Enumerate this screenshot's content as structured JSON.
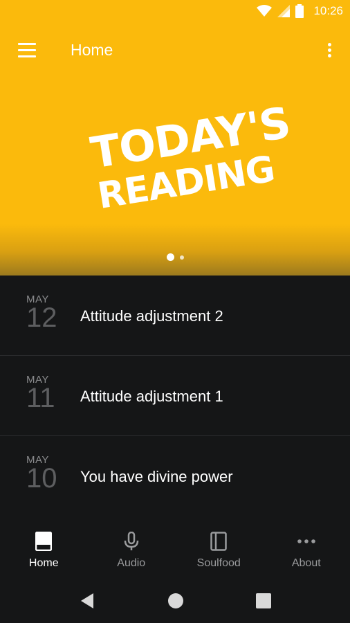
{
  "status_bar": {
    "time": "10:26"
  },
  "app_bar": {
    "title": "Home"
  },
  "hero": {
    "title_line1": "TODAY'S",
    "title_line2": "READING",
    "active_slide": 1,
    "slide_count": 2
  },
  "readings": [
    {
      "month": "MAY",
      "day": "12",
      "title": "Attitude adjustment 2"
    },
    {
      "month": "MAY",
      "day": "11",
      "title": "Attitude adjustment 1"
    },
    {
      "month": "MAY",
      "day": "10",
      "title": "You have divine power"
    }
  ],
  "bottom_nav": [
    {
      "label": "Home",
      "icon": "book-icon",
      "active": true
    },
    {
      "label": "Audio",
      "icon": "microphone-icon",
      "active": false
    },
    {
      "label": "Soulfood",
      "icon": "notebook-icon",
      "active": false
    },
    {
      "label": "About",
      "icon": "more-horizontal-icon",
      "active": false
    }
  ],
  "colors": {
    "accent": "#FBBA0C",
    "background": "#151617",
    "divider": "#2a2b2d"
  }
}
